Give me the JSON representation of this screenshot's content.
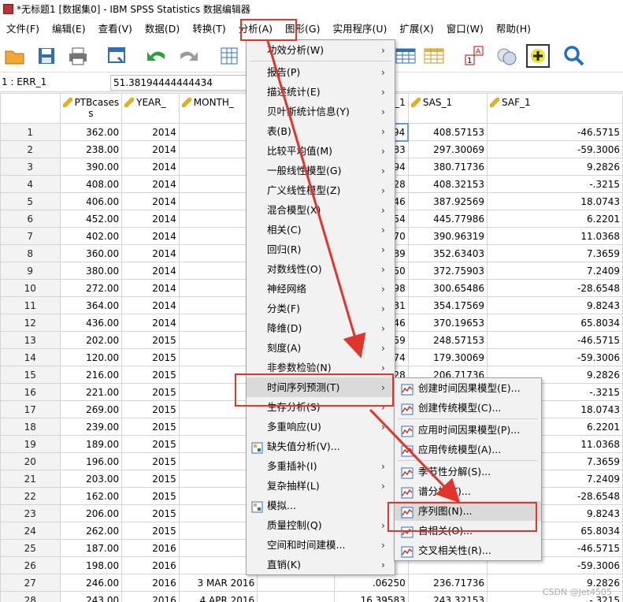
{
  "window": {
    "title": "*无标题1 [数据集0] - IBM SPSS Statistics 数据编辑器"
  },
  "menubar": [
    "文件(F)",
    "编辑(E)",
    "查看(V)",
    "数据(D)",
    "转换(T)",
    "分析(A)",
    "图形(G)",
    "实用程序(U)",
    "扩展(X)",
    "窗口(W)",
    "帮助(H)"
  ],
  "cell_ref": "1 : ERR_1",
  "cell_value": "51.38194444444434",
  "columns": [
    "PTBcases",
    "YEAR_",
    "MONTH_",
    "ERR_1",
    "SAS_1",
    "SAF_1"
  ],
  "col_ptb_line2": "s",
  "rows": [
    {
      "n": "1",
      "p": "362.00",
      "y": "2014",
      "m": "",
      "e": ".38194",
      "s": "408.57153",
      "f": "-46.5715"
    },
    {
      "n": "2",
      "p": "238.00",
      "y": "2014",
      "m": "",
      "e": ".89583",
      "s": "297.30069",
      "f": "-59.3006"
    },
    {
      "n": "3",
      "p": "390.00",
      "y": "2014",
      "m": "",
      "e": ".50694",
      "s": "380.71736",
      "f": "9.2826"
    },
    {
      "n": "4",
      "p": "408.00",
      "y": "2014",
      "m": "",
      "e": ".84028",
      "s": "408.32153",
      "f": "-.3215"
    },
    {
      "n": "5",
      "p": "406.00",
      "y": "2014",
      "m": "",
      "e": ".92546",
      "s": "387.92569",
      "f": "18.0743"
    },
    {
      "n": "6",
      "p": "452.00",
      "y": "2014",
      "m": "",
      "e": ".54954",
      "s": "445.77986",
      "f": "6.2201"
    },
    {
      "n": "7",
      "p": "402.00",
      "y": "2014",
      "m": "",
      "e": ".30370",
      "s": "390.96319",
      "f": "11.0368"
    },
    {
      "n": "8",
      "p": "360.00",
      "y": "2014",
      "m": "",
      "e": ".56389",
      "s": "352.63403",
      "f": "7.3659"
    },
    {
      "n": "9",
      "p": "380.00",
      "y": "2014",
      "m": "",
      "e": ".53750",
      "s": "372.75903",
      "f": "7.2409"
    },
    {
      "n": "10",
      "p": "272.00",
      "y": "2014",
      "m": "1",
      "e": ".41898",
      "s": "300.65486",
      "f": "-28.6548"
    },
    {
      "n": "11",
      "p": "364.00",
      "y": "2014",
      "m": "1",
      "e": ".00231",
      "s": "354.17569",
      "f": "9.8243"
    },
    {
      "n": "12",
      "p": "436.00",
      "y": "2014",
      "m": "1",
      "e": ".52546",
      "s": "370.19653",
      "f": "65.8034"
    },
    {
      "n": "13",
      "p": "202.00",
      "y": "2015",
      "m": "",
      "e": ".71759",
      "s": "248.57153",
      "f": "-46.5715"
    },
    {
      "n": "14",
      "p": "120.00",
      "y": "2015",
      "m": "",
      "e": ".36574",
      "s": "179.30069",
      "f": "-59.3006"
    },
    {
      "n": "15",
      "p": "216.00",
      "y": "2015",
      "m": "",
      "e": ".71528",
      "s": "206.71736",
      "f": "9.2826"
    },
    {
      "n": "16",
      "p": "221.00",
      "y": "2015",
      "m": "",
      "e": "",
      "s": "",
      "f": "-.3215"
    },
    {
      "n": "17",
      "p": "269.00",
      "y": "2015",
      "m": "",
      "e": "",
      "s": "",
      "f": "18.0743"
    },
    {
      "n": "18",
      "p": "239.00",
      "y": "2015",
      "m": "",
      "e": "",
      "s": "",
      "f": "6.2201"
    },
    {
      "n": "19",
      "p": "189.00",
      "y": "2015",
      "m": "",
      "e": "",
      "s": "",
      "f": "11.0368"
    },
    {
      "n": "20",
      "p": "196.00",
      "y": "2015",
      "m": "",
      "e": "",
      "s": "",
      "f": "7.3659"
    },
    {
      "n": "21",
      "p": "203.00",
      "y": "2015",
      "m": "",
      "e": "",
      "s": "",
      "f": "7.2409"
    },
    {
      "n": "22",
      "p": "162.00",
      "y": "2015",
      "m": "1",
      "e": "",
      "s": "",
      "f": "-28.6548"
    },
    {
      "n": "23",
      "p": "206.00",
      "y": "2015",
      "m": "1",
      "e": "",
      "s": "",
      "f": "9.8243"
    },
    {
      "n": "24",
      "p": "262.00",
      "y": "2015",
      "m": "1",
      "e": "",
      "s": "",
      "f": "65.8034"
    },
    {
      "n": "25",
      "p": "187.00",
      "y": "2016",
      "m": "",
      "e": "",
      "s": "",
      "f": "-46.5715"
    },
    {
      "n": "26",
      "p": "198.00",
      "y": "2016",
      "m": "",
      "e": "",
      "s": "",
      "f": "-59.3006"
    },
    {
      "n": "27",
      "p": "246.00",
      "y": "2016",
      "m": "3 MAR 2016",
      "e": ".06250",
      "s": "236.71736",
      "f": "9.2826"
    },
    {
      "n": "28",
      "p": "243.00",
      "y": "2016",
      "m": "4 APR 2016",
      "e": "16.39583",
      "s": "243.32153",
      "f": "-.3215"
    }
  ],
  "analyze_menu": [
    {
      "label": "功效分析(W)",
      "arrow": true
    },
    {
      "sep": true
    },
    {
      "label": "报告(P)",
      "arrow": true
    },
    {
      "label": "描述统计(E)",
      "arrow": true
    },
    {
      "label": "贝叶斯统计信息(Y)",
      "arrow": true
    },
    {
      "label": "表(B)",
      "arrow": true
    },
    {
      "label": "比较平均值(M)",
      "arrow": true
    },
    {
      "label": "一般线性模型(G)",
      "arrow": true
    },
    {
      "label": "广义线性模型(Z)",
      "arrow": true
    },
    {
      "label": "混合模型(X)",
      "arrow": true
    },
    {
      "label": "相关(C)",
      "arrow": true
    },
    {
      "label": "回归(R)",
      "arrow": true
    },
    {
      "label": "对数线性(O)",
      "arrow": true
    },
    {
      "label": "神经网络",
      "arrow": true
    },
    {
      "label": "分类(F)",
      "arrow": true
    },
    {
      "label": "降维(D)",
      "arrow": true
    },
    {
      "label": "刻度(A)",
      "arrow": true
    },
    {
      "label": "非参数检验(N)",
      "arrow": true
    },
    {
      "label": "时间序列预测(T)",
      "arrow": true,
      "hl": true
    },
    {
      "label": "生存分析(S)",
      "arrow": true
    },
    {
      "label": "多重响应(U)",
      "arrow": true
    },
    {
      "label": "缺失值分析(V)...",
      "icon": "missing-value-icon"
    },
    {
      "label": "多重插补(I)",
      "arrow": true
    },
    {
      "label": "复杂抽样(L)",
      "arrow": true
    },
    {
      "label": "模拟...",
      "icon": "simulation-icon"
    },
    {
      "label": "质量控制(Q)",
      "arrow": true
    },
    {
      "label": "空间和时间建模...",
      "arrow": true
    },
    {
      "label": "直销(K)",
      "arrow": true
    }
  ],
  "ts_submenu": [
    {
      "label": "创建时间因果模型(E)..."
    },
    {
      "label": "创建传统模型(C)..."
    },
    {
      "sep": true
    },
    {
      "label": "应用时间因果模型(P)..."
    },
    {
      "label": "应用传统模型(A)..."
    },
    {
      "sep": true
    },
    {
      "label": "季节性分解(S)..."
    },
    {
      "label": "谱分析(T)..."
    },
    {
      "label": "序列图(N)...",
      "hl": true
    },
    {
      "label": "自相关(O)..."
    },
    {
      "label": "交叉相关性(R)..."
    }
  ],
  "watermark": "CSDN @Jet4505",
  "colors": {
    "highlight_red": "#e0342c",
    "menu_bg": "#f2f2f2",
    "accent_blue": "#1e6fc2"
  }
}
